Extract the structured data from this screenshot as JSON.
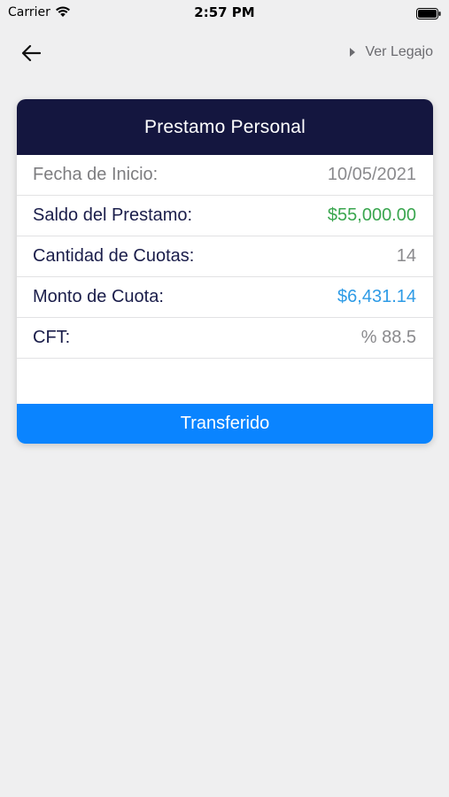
{
  "status_bar": {
    "carrier": "Carrier",
    "time": "2:57 PM",
    "wifi_icon": "wifi-icon",
    "battery_icon": "battery-icon"
  },
  "nav": {
    "back_icon": "arrow-left-icon",
    "legajo_label": "Ver Legajo",
    "legajo_icon": "caret-right-icon"
  },
  "loan_card": {
    "title": "Prestamo Personal",
    "rows": [
      {
        "label": "Fecha de Inicio:",
        "value": "10/05/2021"
      },
      {
        "label": "Saldo del Prestamo:",
        "value": "$55,000.00"
      },
      {
        "label": "Cantidad de Cuotas:",
        "value": "14"
      },
      {
        "label": "Monto de Cuota:",
        "value": "$6,431.14"
      },
      {
        "label": "CFT:",
        "value": "% 88.5"
      }
    ],
    "status_label": "Transferido"
  },
  "colors": {
    "header_bg": "#14163f",
    "accent_blue": "#0a84ff",
    "value_green": "#3aa64f",
    "value_blue": "#2e9be6",
    "background": "#efeff0"
  }
}
